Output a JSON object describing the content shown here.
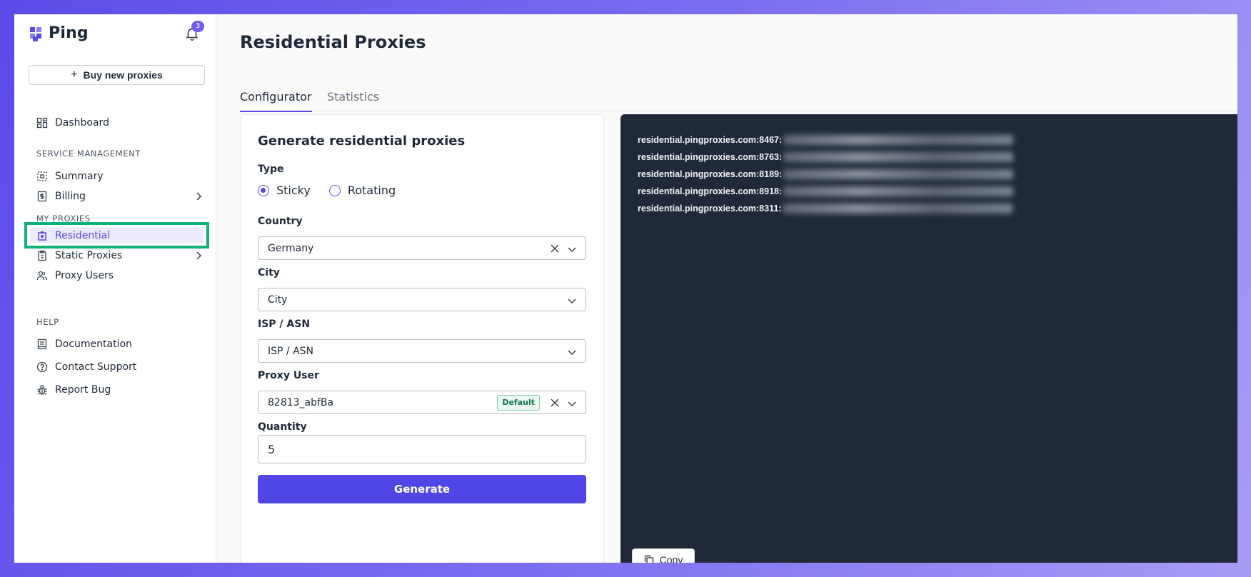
{
  "brand": {
    "name": "Ping",
    "accent": "#5b4cea"
  },
  "notifications": {
    "count": "3"
  },
  "sidebar": {
    "buy_label": "Buy new proxies",
    "dashboard": "Dashboard",
    "sections": {
      "service": "SERVICE MANAGEMENT",
      "proxies": "MY PROXIES",
      "help": "HELP"
    },
    "service_items": [
      "Summary",
      "Billing"
    ],
    "proxy_items": [
      "Residential",
      "Static Proxies",
      "Proxy Users"
    ],
    "help_items": [
      "Documentation",
      "Contact Support",
      "Report Bug"
    ]
  },
  "main": {
    "title": "Residential Proxies",
    "tabs": [
      "Configurator",
      "Statistics"
    ],
    "active_tab": "Configurator"
  },
  "form": {
    "title": "Generate residential proxies",
    "type_label": "Type",
    "type_options": [
      "Sticky",
      "Rotating"
    ],
    "type_selected": "Sticky",
    "country_label": "Country",
    "country_value": "Germany",
    "city_label": "City",
    "city_placeholder": "City",
    "isp_label": "ISP / ASN",
    "isp_placeholder": "ISP / ASN",
    "proxy_user_label": "Proxy User",
    "proxy_user_value": "82813_abfBa",
    "proxy_user_badge": "Default",
    "quantity_label": "Quantity",
    "quantity_value": "5",
    "generate_label": "Generate"
  },
  "output": {
    "lines": [
      "residential.pingproxies.com:8467:",
      "residential.pingproxies.com:8763:",
      "residential.pingproxies.com:8189:",
      "residential.pingproxies.com:8918:",
      "residential.pingproxies.com:8311:"
    ],
    "copy_label": "Copy"
  }
}
